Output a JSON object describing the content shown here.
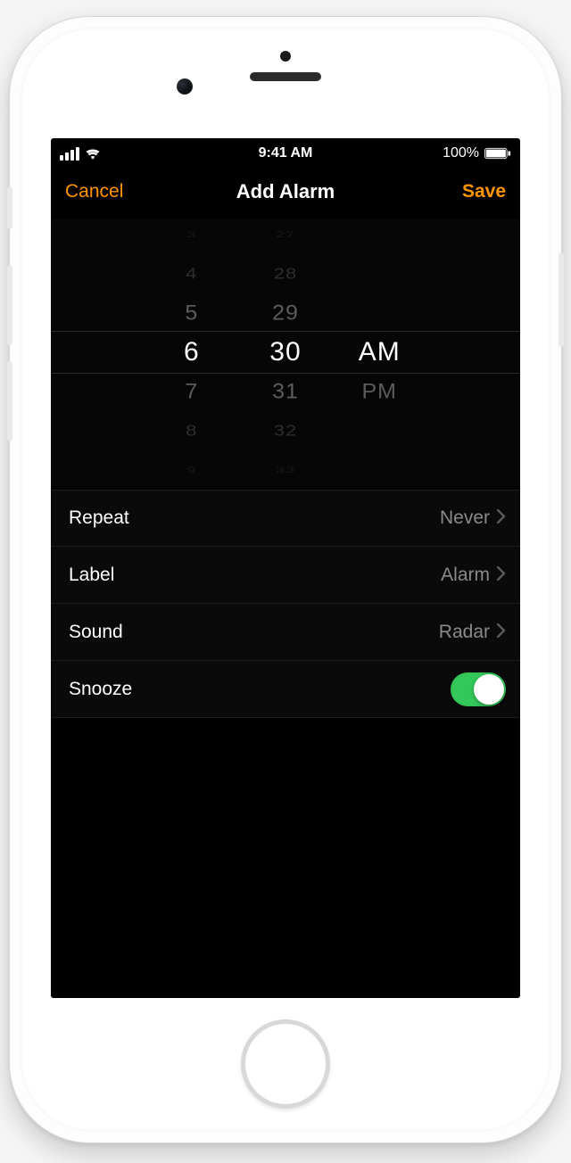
{
  "statusbar": {
    "time": "9:41 AM",
    "battery_pct": "100%"
  },
  "navbar": {
    "cancel": "Cancel",
    "title": "Add Alarm",
    "save": "Save"
  },
  "picker": {
    "hours": [
      "3",
      "4",
      "5",
      "6",
      "7",
      "8",
      "9"
    ],
    "minutes": [
      "27",
      "28",
      "29",
      "30",
      "31",
      "32",
      "33"
    ],
    "ampm": [
      "AM",
      "PM"
    ],
    "selected_hour": "6",
    "selected_minute": "30",
    "selected_ampm": "AM"
  },
  "rows": {
    "repeat": {
      "label": "Repeat",
      "value": "Never"
    },
    "label": {
      "label": "Label",
      "value": "Alarm"
    },
    "sound": {
      "label": "Sound",
      "value": "Radar"
    },
    "snooze": {
      "label": "Snooze",
      "on": true
    }
  },
  "colors": {
    "accent": "#ff9500",
    "toggle_on": "#34c759"
  }
}
